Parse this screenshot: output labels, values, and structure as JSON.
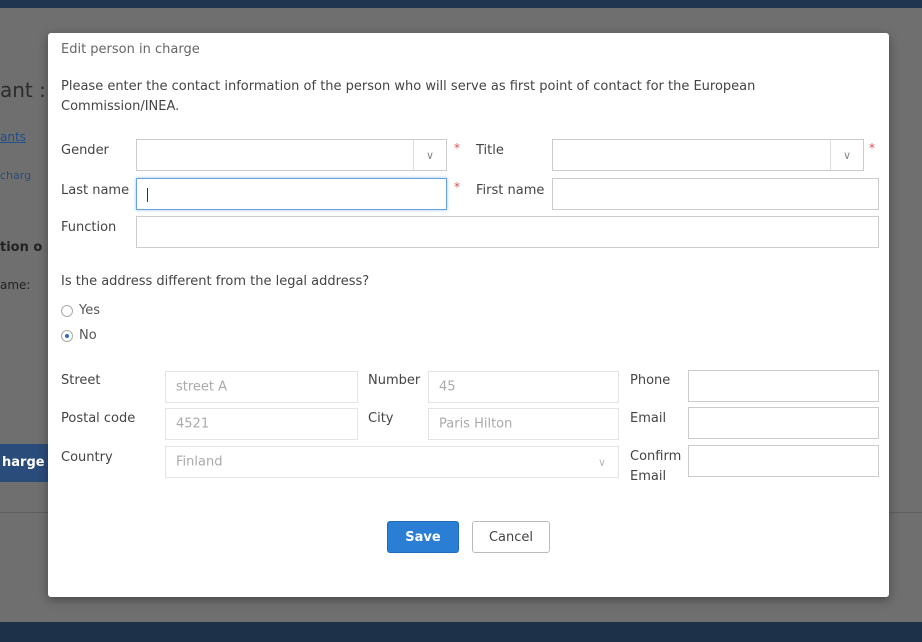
{
  "background": {
    "page_title_fragment": "ant :",
    "link_fragment": "ants",
    "subtitle_fragment": "charg",
    "section_fragment": "tion o",
    "name_fragment": "ame:",
    "button_fragment": "harge"
  },
  "modal": {
    "title": "Edit person in charge",
    "intro": "Please enter the contact information of the person who will serve as first point of contact for the European Commission/INEA.",
    "required_marker": "*",
    "fields": {
      "gender": {
        "label": "Gender",
        "value": ""
      },
      "title": {
        "label": "Title",
        "value": ""
      },
      "last_name": {
        "label": "Last name",
        "value": ""
      },
      "first_name": {
        "label": "First name",
        "value": ""
      },
      "function": {
        "label": "Function",
        "value": ""
      }
    },
    "address_question": "Is the address different from the legal address?",
    "address_options": [
      {
        "label": "Yes",
        "checked": false
      },
      {
        "label": "No",
        "checked": true
      }
    ],
    "address": {
      "street": {
        "label": "Street",
        "value": "street A"
      },
      "number": {
        "label": "Number",
        "value": "45"
      },
      "phone": {
        "label": "Phone",
        "value": ""
      },
      "postal_code": {
        "label": "Postal code",
        "value": "4521"
      },
      "city": {
        "label": "City",
        "value": "Paris Hilton"
      },
      "email": {
        "label": "Email",
        "value": ""
      },
      "country": {
        "label": "Country",
        "value": "Finland"
      },
      "confirm_email": {
        "label_line1": "Confirm",
        "label_line2": "Email",
        "value": ""
      }
    },
    "buttons": {
      "save": "Save",
      "cancel": "Cancel"
    }
  },
  "icons": {
    "select_arrow": "chevron-down-icon",
    "radio": "radio-icon"
  },
  "colors": {
    "primary_button": "#2a7fd4",
    "required": "#d9534f",
    "focus_border": "#66a3e0"
  }
}
